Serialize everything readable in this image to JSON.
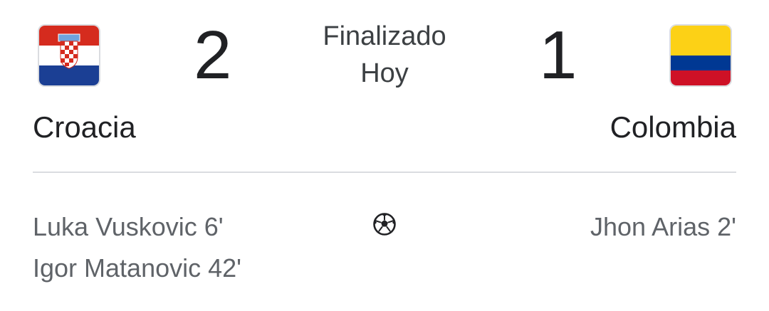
{
  "match": {
    "status": "Finalizado",
    "date": "Hoy"
  },
  "home": {
    "name": "Croacia",
    "score": "2",
    "flag_icon": "croatia-flag-icon",
    "scorers": [
      "Luka Vuskovic 6'",
      "Igor Matanovic 42'"
    ]
  },
  "away": {
    "name": "Colombia",
    "score": "1",
    "flag_icon": "colombia-flag-icon",
    "scorers": [
      "Jhon Arias 2'"
    ]
  },
  "goal_icon": "soccer-ball-icon",
  "colors": {
    "croatia_red": "#d52b1e",
    "croatia_white": "#ffffff",
    "croatia_blue": "#1b3f94",
    "colombia_yellow": "#fcd116",
    "colombia_blue": "#003893",
    "colombia_red": "#ce1126",
    "divider": "#dadce0",
    "text_primary": "#202124",
    "text_secondary": "#5f6368"
  }
}
